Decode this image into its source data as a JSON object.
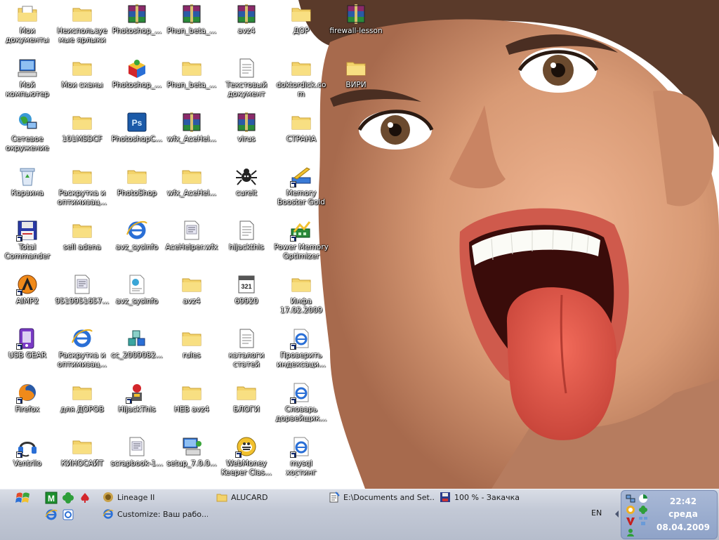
{
  "desktop": {
    "icons": [
      {
        "label": "Мои документы",
        "icon": "folder-documents-icon",
        "col": 0,
        "row": 0
      },
      {
        "label": "Неиспользуемые ярлыки",
        "display": "Неиспользу...\nярлыки",
        "icon": "folder-icon",
        "col": 1,
        "row": 0
      },
      {
        "label": "Photoshop_...",
        "icon": "winrar-archive-icon",
        "col": 2,
        "row": 0
      },
      {
        "label": "Phun_beta_...",
        "icon": "winrar-archive-icon",
        "col": 3,
        "row": 0
      },
      {
        "label": "avz4",
        "icon": "winrar-archive-icon",
        "col": 4,
        "row": 0
      },
      {
        "label": "ДОР",
        "icon": "folder-icon",
        "col": 5,
        "row": 0
      },
      {
        "label": "firewall-lesson",
        "icon": "winrar-archive-icon",
        "col": 6,
        "row": 0
      },
      {
        "label": "Мой компьютер",
        "icon": "my-computer-icon",
        "col": 0,
        "row": 1
      },
      {
        "label": "Мои сканы",
        "icon": "folder-icon",
        "col": 1,
        "row": 1
      },
      {
        "label": "Photoshop_...",
        "icon": "installer-box-icon",
        "col": 2,
        "row": 1
      },
      {
        "label": "Phun_beta_...",
        "icon": "folder-icon",
        "col": 3,
        "row": 1
      },
      {
        "label": "Текстовый документ",
        "icon": "text-document-icon",
        "col": 4,
        "row": 1
      },
      {
        "label": "doktordick.com",
        "icon": "folder-icon",
        "col": 5,
        "row": 1
      },
      {
        "label": "ВИРИ",
        "icon": "folder-icon",
        "col": 6,
        "row": 1
      },
      {
        "label": "Сетевое окружение",
        "icon": "network-places-icon",
        "col": 0,
        "row": 2
      },
      {
        "label": "101MSDCF",
        "icon": "folder-icon",
        "col": 1,
        "row": 2
      },
      {
        "label": "PhotoshopC...",
        "icon": "photoshop-icon",
        "col": 2,
        "row": 2
      },
      {
        "label": "wfx_AceHel...",
        "icon": "winrar-archive-icon",
        "col": 3,
        "row": 2
      },
      {
        "label": "virus",
        "icon": "winrar-archive-icon",
        "col": 4,
        "row": 2
      },
      {
        "label": "СТРАНА",
        "icon": "folder-icon",
        "col": 5,
        "row": 2
      },
      {
        "label": "Корзина",
        "icon": "recycle-bin-icon",
        "col": 0,
        "row": 3
      },
      {
        "label": "Раскрутка и оптимизац...",
        "icon": "folder-icon",
        "col": 1,
        "row": 3
      },
      {
        "label": "PhotoShop",
        "icon": "folder-icon",
        "col": 2,
        "row": 3
      },
      {
        "label": "wfx_AceHel...",
        "icon": "folder-icon",
        "col": 3,
        "row": 3
      },
      {
        "label": "cureit",
        "icon": "spider-icon",
        "col": 4,
        "row": 3
      },
      {
        "label": "Memory Booster Gold",
        "icon": "memory-booster-icon",
        "col": 5,
        "row": 3,
        "shortcut": true
      },
      {
        "label": "Total Commander",
        "icon": "floppy-disk-icon",
        "col": 0,
        "row": 4,
        "shortcut": true
      },
      {
        "label": "sell adena",
        "icon": "folder-icon",
        "col": 1,
        "row": 4
      },
      {
        "label": "avz_sysinfo",
        "icon": "internet-explorer-icon",
        "col": 2,
        "row": 4
      },
      {
        "label": "AceHelper.wfx",
        "icon": "file-icon",
        "col": 3,
        "row": 4
      },
      {
        "label": "hijackthis",
        "icon": "text-document-icon",
        "col": 4,
        "row": 4
      },
      {
        "label": "Power Memory Optimizer",
        "icon": "memory-optimizer-icon",
        "col": 5,
        "row": 4,
        "shortcut": true
      },
      {
        "label": "AIMP2",
        "icon": "aimp-icon",
        "col": 0,
        "row": 5,
        "shortcut": true
      },
      {
        "label": "9519951657...",
        "icon": "file-icon",
        "col": 1,
        "row": 5
      },
      {
        "label": "avz_sysinfo",
        "icon": "html-document-icon",
        "col": 2,
        "row": 5
      },
      {
        "label": "avz4",
        "icon": "folder-icon",
        "col": 3,
        "row": 5
      },
      {
        "label": "69920",
        "icon": "calendar-file-icon",
        "col": 4,
        "row": 5
      },
      {
        "label": "Инфа 17.02.2009",
        "icon": "folder-icon",
        "col": 5,
        "row": 5
      },
      {
        "label": "USB GEAR",
        "icon": "usb-gear-icon",
        "col": 0,
        "row": 6,
        "shortcut": true
      },
      {
        "label": "Раскрутка и оптимизац...",
        "icon": "internet-explorer-icon",
        "col": 1,
        "row": 6
      },
      {
        "label": "cc_2009082...",
        "icon": "cubes-icon",
        "col": 2,
        "row": 6
      },
      {
        "label": "rules",
        "icon": "folder-icon",
        "col": 3,
        "row": 6
      },
      {
        "label": "каталоги статей",
        "icon": "text-document-icon",
        "col": 4,
        "row": 6
      },
      {
        "label": "Проверить индексаци...",
        "icon": "ie-document-icon",
        "col": 5,
        "row": 6,
        "shortcut": true
      },
      {
        "label": "Firefox",
        "icon": "firefox-icon",
        "col": 0,
        "row": 7,
        "shortcut": true
      },
      {
        "label": "для ДОРОВ",
        "icon": "folder-icon",
        "col": 1,
        "row": 7
      },
      {
        "label": "HijackThis",
        "icon": "hijackthis-icon",
        "col": 2,
        "row": 7,
        "shortcut": true
      },
      {
        "label": "НЕВ avz4",
        "icon": "folder-icon",
        "col": 3,
        "row": 7
      },
      {
        "label": "БЛОГИ",
        "icon": "folder-icon",
        "col": 4,
        "row": 7
      },
      {
        "label": "Словарь дорвейщик...",
        "icon": "ie-document-icon",
        "col": 5,
        "row": 7,
        "shortcut": true
      },
      {
        "label": "Ventrilo",
        "icon": "ventrilo-headset-icon",
        "col": 0,
        "row": 8,
        "shortcut": true
      },
      {
        "label": "КИНОСАЙТ",
        "icon": "folder-icon",
        "col": 1,
        "row": 8
      },
      {
        "label": "scrapbook-1...",
        "icon": "file-icon",
        "col": 2,
        "row": 8
      },
      {
        "label": "setup_7.0.0...",
        "icon": "setup-computer-icon",
        "col": 3,
        "row": 8
      },
      {
        "label": "WebMoney Keeper Clas...",
        "icon": "webmoney-bee-icon",
        "col": 4,
        "row": 8,
        "shortcut": true
      },
      {
        "label": "mysql хостинг тарифные п...",
        "icon": "ie-document-icon",
        "col": 5,
        "row": 8,
        "shortcut": true
      }
    ]
  },
  "taskbar": {
    "start_icon": "windows-flag-icon",
    "quicklaunch": [
      {
        "icon": "green-m-icon"
      },
      {
        "icon": "clover-icon"
      },
      {
        "icon": "spade-icon"
      },
      {
        "icon": "internet-explorer-icon"
      },
      {
        "icon": "ie-edit-icon"
      }
    ],
    "buttons": [
      {
        "label": "Lineage II",
        "icon": "lineage-icon"
      },
      {
        "label": "ALUCARD",
        "icon": "folder-icon"
      },
      {
        "label": "E:\\Documents and Set...",
        "icon": "notepad-icon"
      },
      {
        "label": "100 % - Закачка",
        "icon": "download-icon"
      },
      {
        "label": "Customize: Ваш рабо...",
        "icon": "internet-explorer-icon"
      }
    ],
    "language": "EN",
    "clock": {
      "time": "22:42",
      "day": "среда",
      "date": "08.04.2009"
    }
  },
  "colors": {
    "taskbar_top": "#d9dde6",
    "taskbar_bottom": "#b6bdcc",
    "tray": "#8fa3c8",
    "folder": "#f3d36b",
    "lips": "#d9544a",
    "tongue": "#e85a4c"
  }
}
